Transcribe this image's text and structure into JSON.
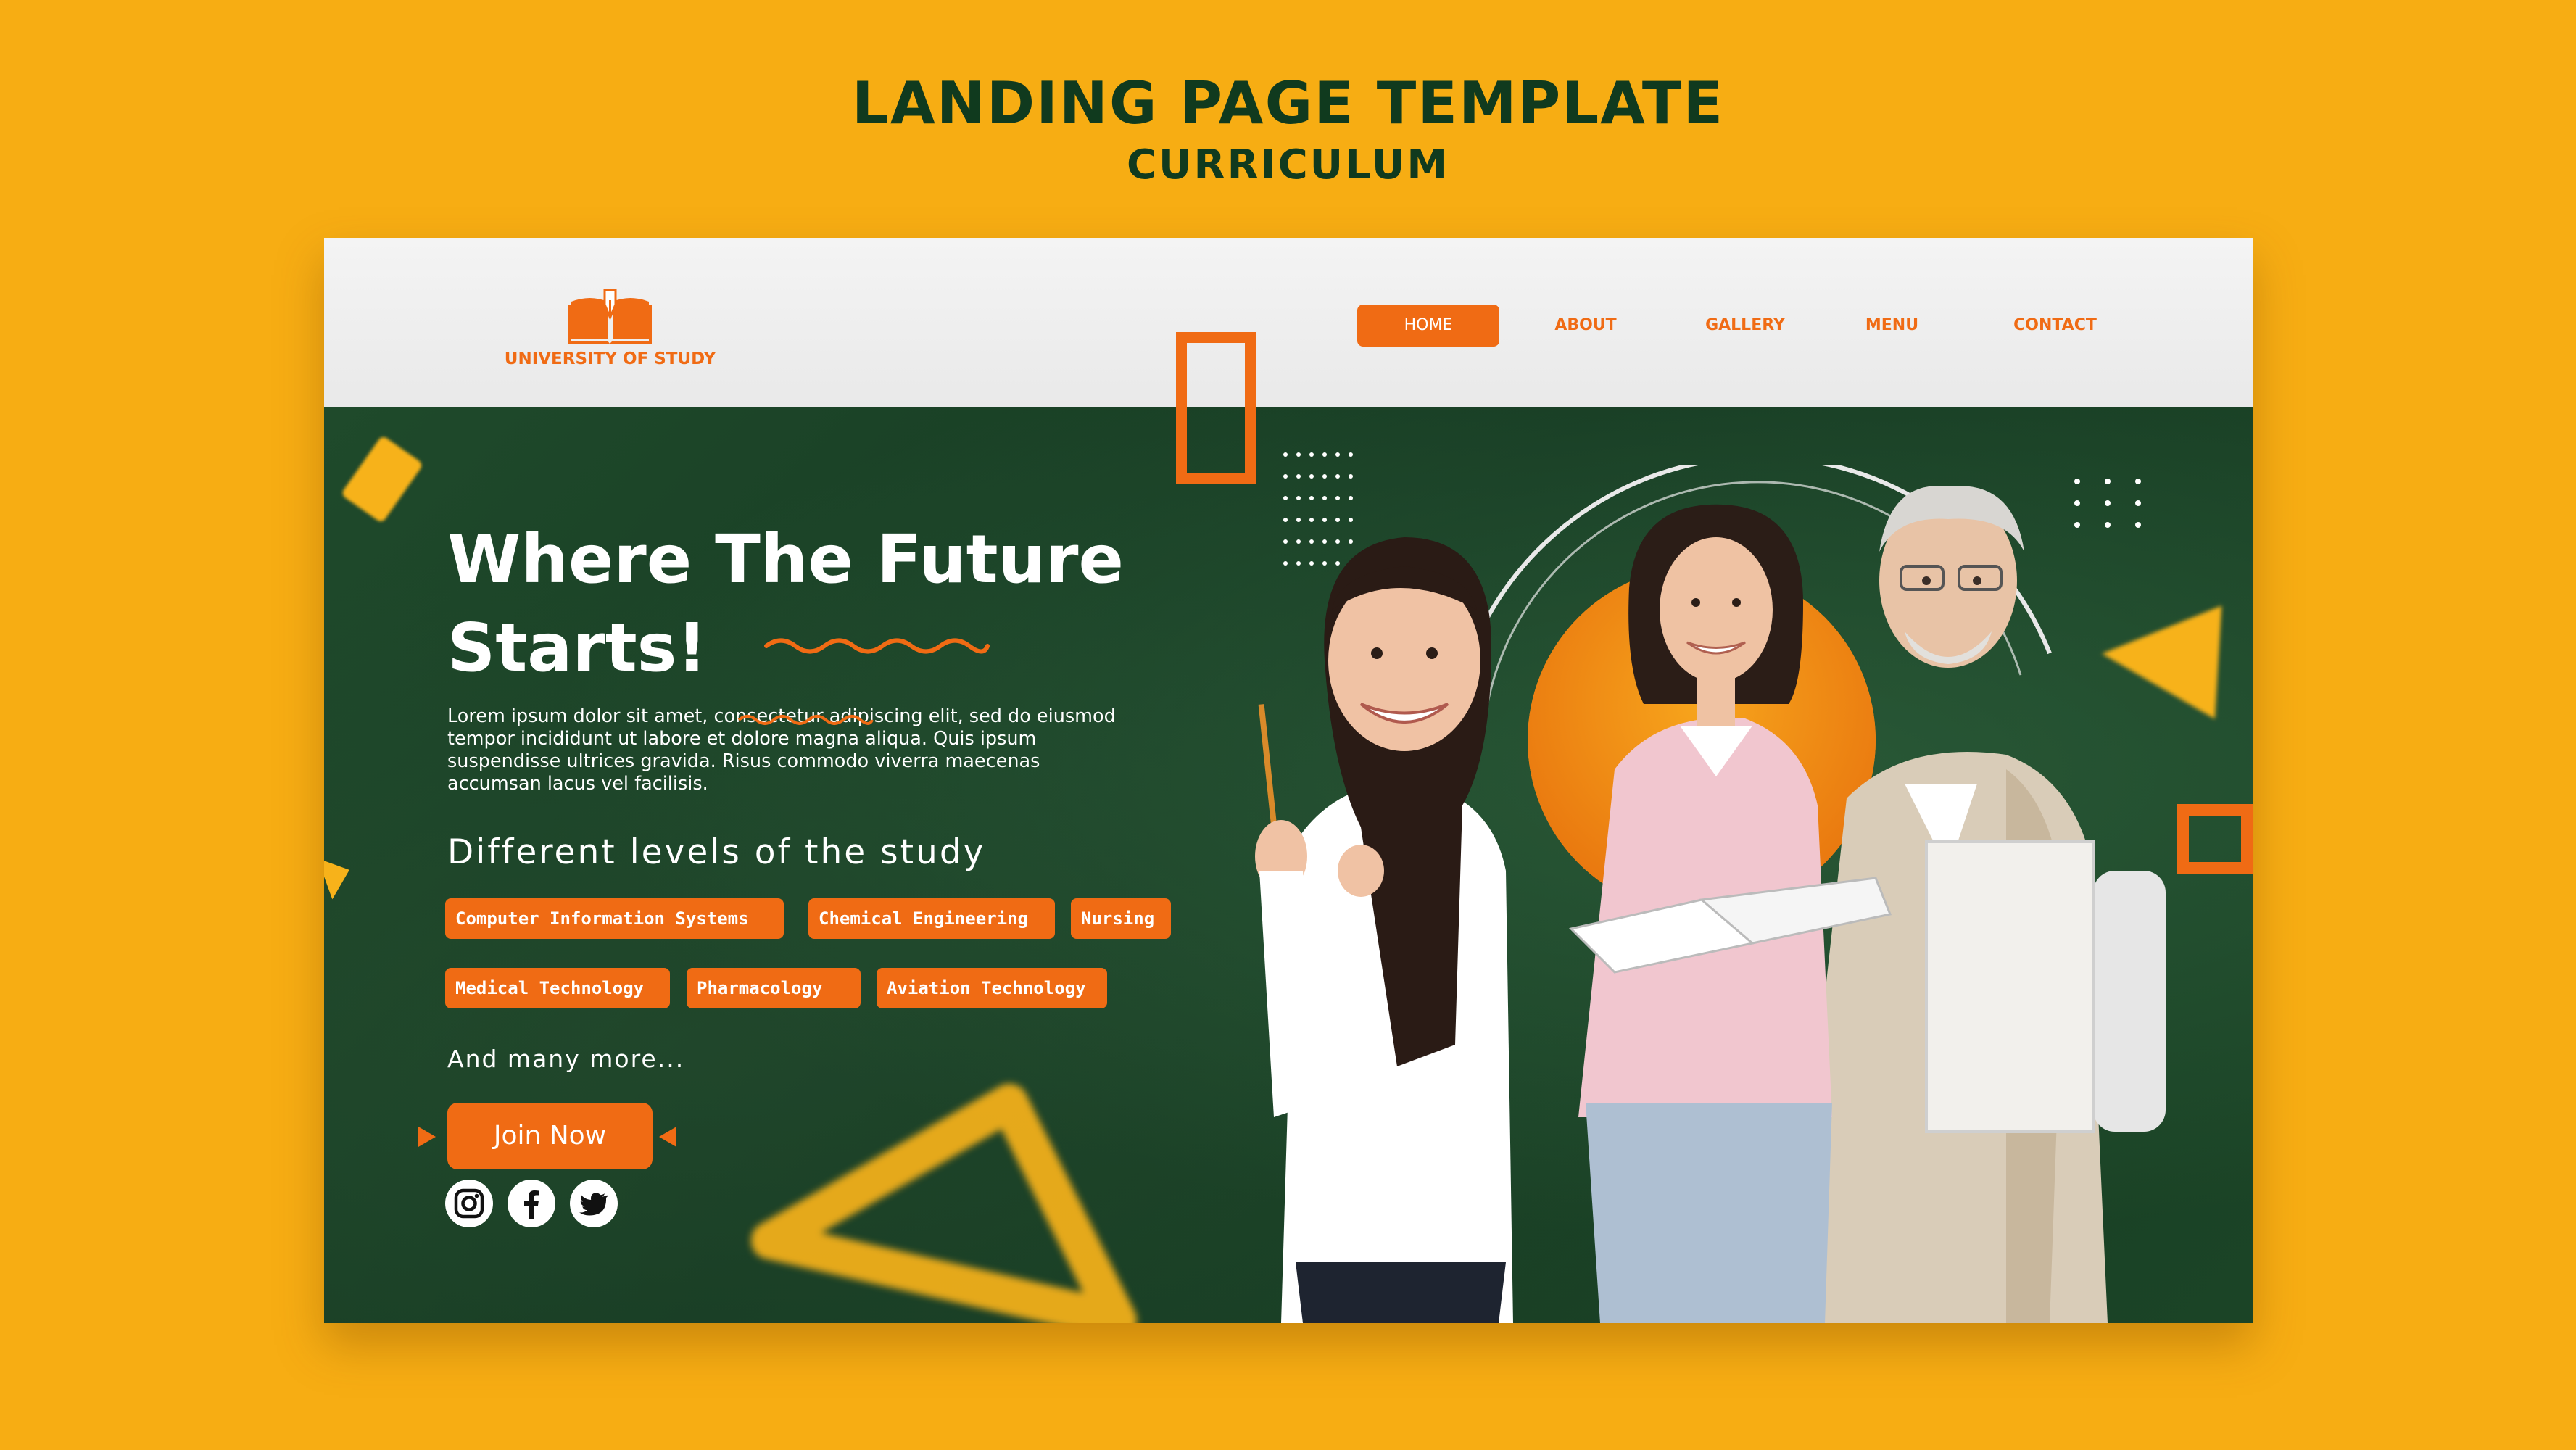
{
  "page": {
    "title": "LANDING PAGE TEMPLATE",
    "subtitle": "CURRICULUM"
  },
  "header": {
    "logo_text": "UNIVERSITY OF STUDY",
    "nav": [
      "HOME",
      "ABOUT",
      "GALLERY",
      "MENU",
      "CONTACT"
    ],
    "active_nav": "HOME"
  },
  "hero": {
    "title_line1": "Where The Future",
    "title_line2": "Starts!",
    "body": "Lorem ipsum dolor sit amet, consectetur adipiscing elit, sed do eiusmod tempor incididunt ut labore et dolore magna aliqua. Quis ipsum suspendisse ultrices gravida. Risus commodo viverra maecenas accumsan lacus vel facilisis.",
    "levels_title": "Different levels of the study",
    "tags": [
      "Computer Information Systems",
      "Chemical Engineering",
      "Nursing",
      "Medical Technology",
      "Pharmacology",
      "Aviation Technology"
    ],
    "more": "And many more...",
    "cta": "Join Now",
    "social_icons": [
      "instagram-icon",
      "facebook-icon",
      "twitter-icon"
    ]
  },
  "colors": {
    "background": "#f7ad13",
    "heading": "#103a1e",
    "accent": "#f06b14",
    "hero_bg": "#1a4025",
    "yellow": "#f7b21a"
  }
}
